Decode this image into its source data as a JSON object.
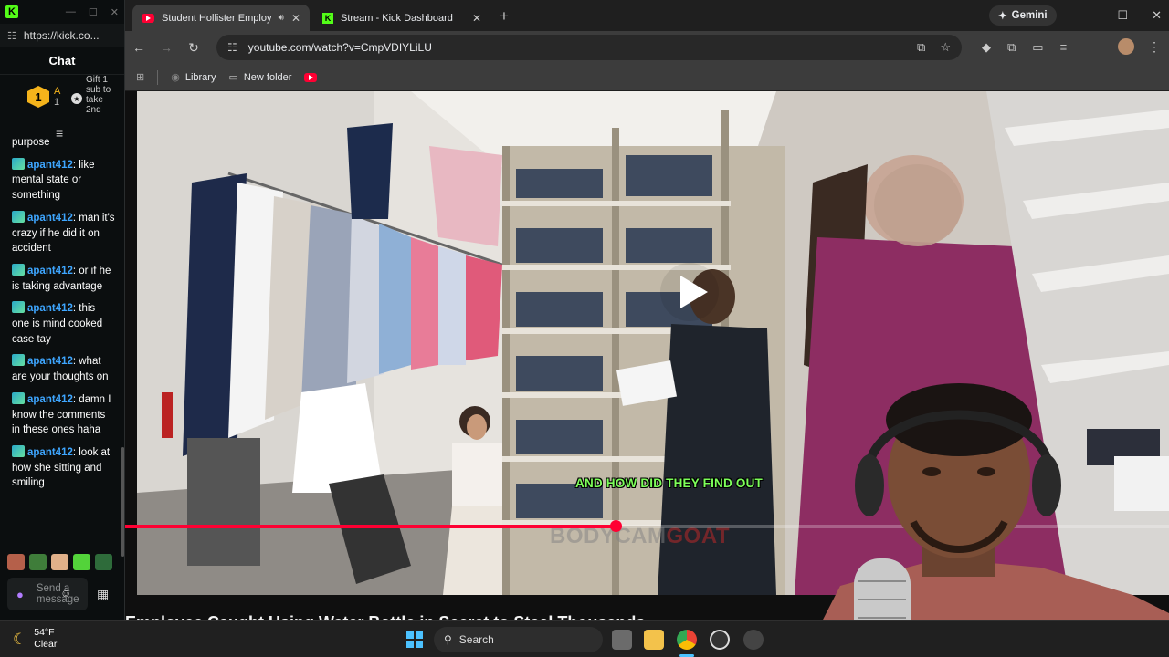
{
  "kick_window": {
    "url": "https://kick.co...",
    "chat_title": "Chat",
    "pinned": {
      "rank": "1",
      "user_initial": "A",
      "count": "1",
      "gift_text": "Gift 1 sub to take 2nd"
    },
    "messages": [
      {
        "user": "",
        "text": "purpose"
      },
      {
        "user": "apant412",
        "text": "like mental state or something"
      },
      {
        "user": "apant412",
        "text": "man it's crazy if he did it on accident"
      },
      {
        "user": "apant412",
        "text": "or if he is taking advantage"
      },
      {
        "user": "apant412",
        "text": "this one is mind cooked case tay"
      },
      {
        "user": "apant412",
        "text": "what are your thoughts on"
      },
      {
        "user": "apant412",
        "text": "damn I know the comments in these ones haha"
      },
      {
        "user": "apant412",
        "text": "look at how she sitting and smiling"
      }
    ],
    "input_placeholder": "Send a message"
  },
  "browser": {
    "tabs": [
      {
        "title": "Student Hollister Employee",
        "favicon": "youtube-icon",
        "active": true
      },
      {
        "title": "Stream - Kick Dashboard",
        "favicon": "kick-icon",
        "active": false
      }
    ],
    "gemini_label": "Gemini",
    "url": "youtube.com/watch?v=CmpVDIYLiLU",
    "bookmarks": [
      {
        "label": "Library",
        "icon": "library-icon"
      },
      {
        "label": "New folder",
        "icon": "folder-icon"
      }
    ]
  },
  "video": {
    "subtitle": "AND HOW DID THEY FIND OUT",
    "watermark_a": "BODYCAM",
    "watermark_b": "GOAT",
    "progress": 0.47,
    "title_partial": "Employee Caught Using Water Bottle in Secret to Steal Thousands"
  },
  "taskbar": {
    "temperature": "54°F",
    "condition": "Clear",
    "search_label": "Search"
  },
  "colors": {
    "kick_green": "#53fc18",
    "youtube_red": "#ff0033",
    "chat_user": "#3ea6ff",
    "subtitle_green": "#7dff5a"
  }
}
